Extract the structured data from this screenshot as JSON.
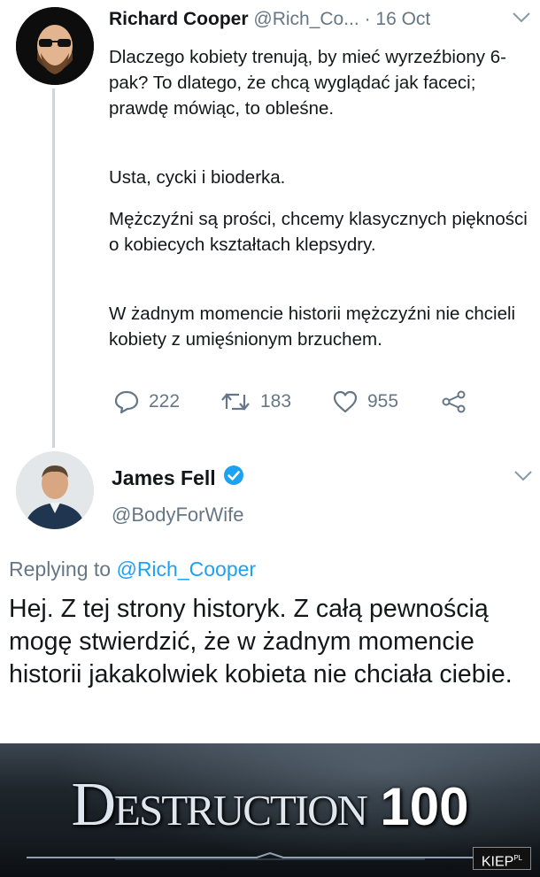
{
  "tweet1": {
    "name": "Richard Cooper",
    "handle": "@Rich_Co...",
    "time": "· 16 Oct",
    "paragraphs": [
      "Dlaczego kobiety trenują, by mieć wyrzeźbiony 6-pak? To dlatego, że chcą wyglądać jak faceci; prawdę mówiąc, to obleśne.",
      "Usta, cycki i bioderka.",
      "Mężczyźni są prości, chcemy klasycznych piękności o kobiecych kształtach klepsydry.",
      "W żadnym momencie historii mężczyźni nie chcieli kobiety z umięśnionym brzuchem."
    ],
    "actions": {
      "reply_count": "222",
      "retweet_count": "183",
      "like_count": "955"
    }
  },
  "tweet2": {
    "name": "James Fell",
    "handle": "@BodyForWife",
    "replying_prefix": "Replying to",
    "replying_handle": "@Rich_Cooper",
    "text": "Hej. Z tej strony historyk. Z całą pewnością mogę stwierdzić, że w żadnym momencie historii jakakolwiek kobieta nie chciała ciebie."
  },
  "banner": {
    "word": "Destruction",
    "number": "100"
  },
  "watermark": {
    "brand": "KIEP",
    "suffix": "PL"
  },
  "colors": {
    "text": "#14171a",
    "secondary": "#657786",
    "link": "#1da1f2",
    "verified": "#1da1f2"
  },
  "icons": [
    "chevron-down-icon",
    "reply-icon",
    "retweet-icon",
    "like-icon",
    "share-icon",
    "verified-badge-icon"
  ]
}
